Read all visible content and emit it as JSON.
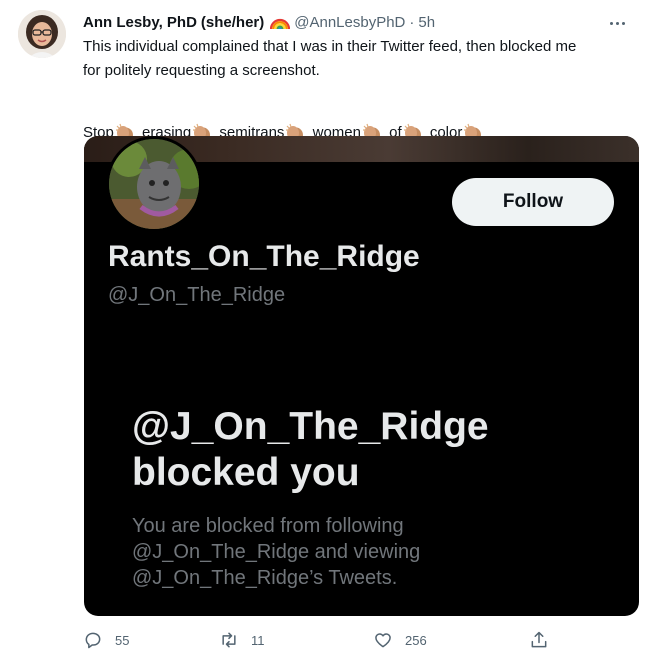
{
  "tweet": {
    "author_name": "Ann Lesby, PhD",
    "pronouns": "(she/her)",
    "handle": "@AnnLesbyPhD",
    "separator": "·",
    "time": "5h",
    "text_line1": "This individual complained that I was in their Twitter feed, then blocked me",
    "text_line2": "for politely requesting a screenshot.",
    "clap_words": [
      "Stop",
      "erasing",
      "semitrans",
      "women",
      "of",
      "color"
    ],
    "clap_emoji": "clapping-hands-icon"
  },
  "embedded_card": {
    "follow_label": "Follow",
    "display_name": "Rants_On_The_Ridge",
    "handle": "@J_On_The_Ridge",
    "blocked_title_line1": "@J_On_The_Ridge",
    "blocked_title_line2": "blocked you",
    "desc_line1": "You are blocked from following",
    "desc_line2": "@J_On_The_Ridge and viewing",
    "desc_line3": "@J_On_The_Ridge’s Tweets."
  },
  "actions": {
    "reply_count": "55",
    "retweet_count": "11",
    "like_count": "256"
  },
  "colors": {
    "text_primary": "#0f1419",
    "text_secondary": "#536471",
    "card_bg": "#000000",
    "card_text": "#e7e9ea",
    "card_muted": "#71767b",
    "follow_bg": "#eff3f4"
  }
}
